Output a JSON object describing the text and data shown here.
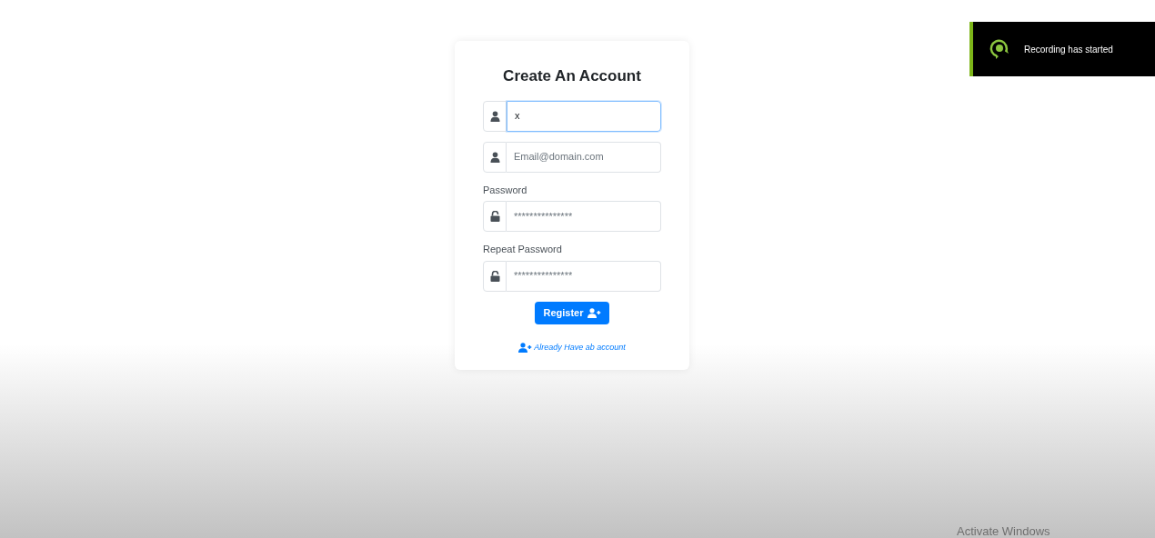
{
  "form": {
    "title": "Create An Account",
    "fields": [
      {
        "kind": "text",
        "value": "x",
        "focused": true
      },
      {
        "kind": "text",
        "placeholder": "Email@domain.com",
        "focused": false
      },
      {
        "kind": "password",
        "label": "Password",
        "placeholder": "***************",
        "focused": false
      },
      {
        "kind": "password",
        "label": "Repeat Password",
        "placeholder": "***************",
        "focused": false
      }
    ],
    "submit": "Register",
    "login_link": "Already Have ab account"
  },
  "toast": {
    "message": "Recording has started"
  },
  "os_notice": "Activate Windows"
}
